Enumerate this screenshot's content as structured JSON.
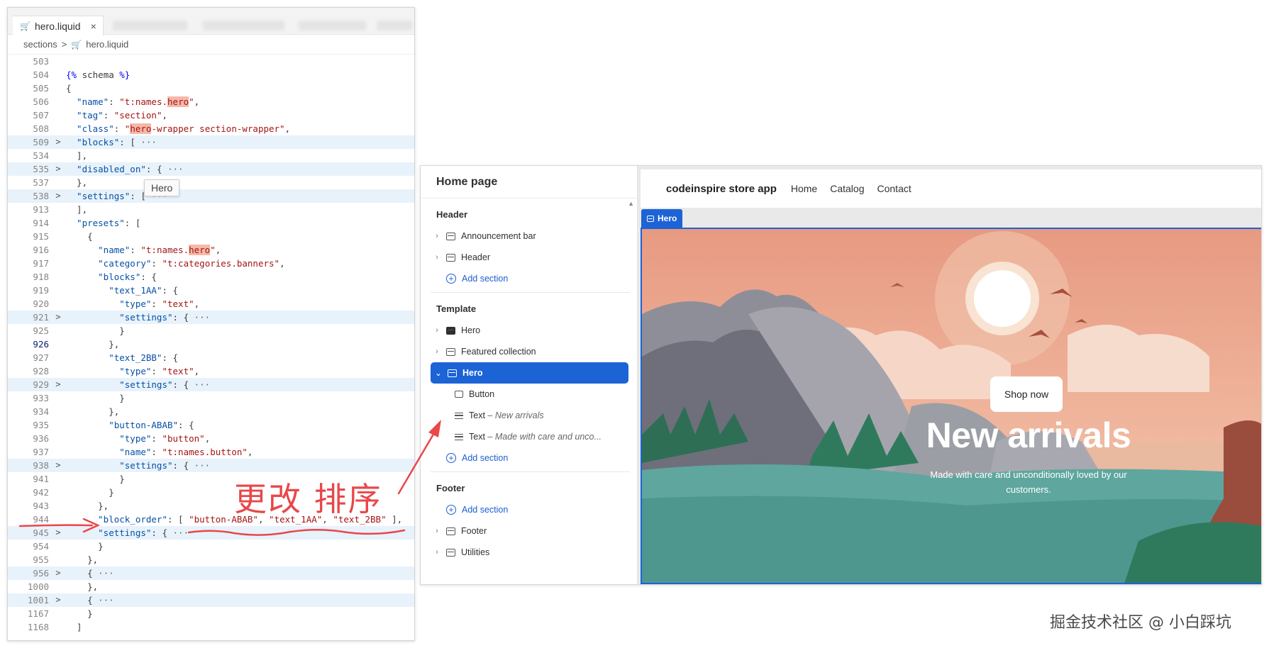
{
  "editor": {
    "tab_label": "hero.liquid",
    "tab_close": "×",
    "breadcrumb": [
      "sections",
      ">",
      "hero.liquid"
    ],
    "hover_tooltip": "Hero",
    "lines": [
      {
        "n": "503",
        "html": ""
      },
      {
        "n": "504",
        "html": "<span class='k'>{%</span> <span class='p'>schema</span> <span class='k'>%}</span>"
      },
      {
        "n": "505",
        "html": "<span class='p'>{</span>"
      },
      {
        "n": "506",
        "html": "  \"name\"<span class='p'>: </span><span class='s'>\"t:names.<span class='mark'>hero</span>\"</span><span class='p'>,</span>"
      },
      {
        "n": "507",
        "html": "  \"tag\"<span class='p'>: </span><span class='s'>\"section\"</span><span class='p'>,</span>"
      },
      {
        "n": "508",
        "html": "  \"class\"<span class='p'>: </span><span class='s'>\"<span class='mark'>hero</span>-wrapper section-wrapper\"</span><span class='p'>,</span>"
      },
      {
        "n": "509",
        "fold": ">",
        "hl": true,
        "html": "  \"blocks\"<span class='p'>: [</span> <span class='m'>···</span>"
      },
      {
        "n": "534",
        "html": "<span class='p'>  ],</span>"
      },
      {
        "n": "535",
        "fold": ">",
        "hl": true,
        "html": "  \"disabled_on\"<span class='p'>: {</span> <span class='m'>···</span>"
      },
      {
        "n": "537",
        "html": "<span class='p'>  },</span>"
      },
      {
        "n": "538",
        "fold": ">",
        "hl": true,
        "html": "  \"settings\"<span class='p'>: [</span> <span class='m'>···</span>"
      },
      {
        "n": "913",
        "html": "<span class='p'>  ],</span>"
      },
      {
        "n": "914",
        "html": "  \"presets\"<span class='p'>: [</span>"
      },
      {
        "n": "915",
        "html": "<span class='p'>    {</span>"
      },
      {
        "n": "916",
        "html": "      \"name\"<span class='p'>: </span><span class='s'>\"t:names.<span class='mark'>hero</span>\"</span><span class='p'>,</span>"
      },
      {
        "n": "917",
        "html": "      \"category\"<span class='p'>: </span><span class='s'>\"t:categories.banners\"</span><span class='p'>,</span>"
      },
      {
        "n": "918",
        "html": "      \"blocks\"<span class='p'>: {</span>"
      },
      {
        "n": "919",
        "html": "        \"text_1AA\"<span class='p'>: {</span>"
      },
      {
        "n": "920",
        "html": "          \"type\"<span class='p'>: </span><span class='s'>\"text\"</span><span class='p'>,</span>"
      },
      {
        "n": "921",
        "fold": ">",
        "hl": true,
        "html": "          \"settings\"<span class='p'>: {</span> <span class='m'>···</span>"
      },
      {
        "n": "925",
        "html": "<span class='p'>          }</span>"
      },
      {
        "n": "926",
        "cur": true,
        "html": "<span class='p'>        },</span>"
      },
      {
        "n": "927",
        "html": "        \"text_2BB\"<span class='p'>: {</span>"
      },
      {
        "n": "928",
        "html": "          \"type\"<span class='p'>: </span><span class='s'>\"text\"</span><span class='p'>,</span>"
      },
      {
        "n": "929",
        "fold": ">",
        "hl": true,
        "html": "          \"settings\"<span class='p'>: {</span> <span class='m'>···</span>"
      },
      {
        "n": "933",
        "html": "<span class='p'>          }</span>"
      },
      {
        "n": "934",
        "html": "<span class='p'>        },</span>"
      },
      {
        "n": "935",
        "html": "        \"button-ABAB\"<span class='p'>: {</span>"
      },
      {
        "n": "936",
        "html": "          \"type\"<span class='p'>: </span><span class='s'>\"button\"</span><span class='p'>,</span>"
      },
      {
        "n": "937",
        "html": "          \"name\"<span class='p'>: </span><span class='s'>\"t:names.button\"</span><span class='p'>,</span>"
      },
      {
        "n": "938",
        "fold": ">",
        "hl": true,
        "html": "          \"settings\"<span class='p'>: {</span> <span class='m'>···</span>"
      },
      {
        "n": "941",
        "html": "<span class='p'>          }</span>"
      },
      {
        "n": "942",
        "html": "<span class='p'>        }</span>"
      },
      {
        "n": "943",
        "html": "<span class='p'>      },</span>"
      },
      {
        "n": "944",
        "html": "      \"block_order\"<span class='p'>: [ </span><span class='s'>\"button-ABAB\"</span><span class='p'>, </span><span class='s'>\"text_1AA\"</span><span class='p'>, </span><span class='s'>\"text_2BB\"</span><span class='p'> ],</span>"
      },
      {
        "n": "945",
        "fold": ">",
        "hl": true,
        "html": "      \"settings\"<span class='p'>: {</span> <span class='m'>···</span>"
      },
      {
        "n": "954",
        "html": "<span class='p'>      }</span>"
      },
      {
        "n": "955",
        "html": "<span class='p'>    },</span>"
      },
      {
        "n": "956",
        "fold": ">",
        "hl": true,
        "html": "<span class='p'>    {</span> <span class='m'>···</span>"
      },
      {
        "n": "1000",
        "html": "<span class='p'>    },</span>"
      },
      {
        "n": "1001",
        "fold": ">",
        "hl": true,
        "html": "<span class='p'>    {</span> <span class='m'>···</span>"
      },
      {
        "n": "1167",
        "html": "<span class='p'>    }</span>"
      },
      {
        "n": "1168",
        "html": "<span class='p'>  ]</span>"
      }
    ]
  },
  "customizer": {
    "panel_title": "Home page",
    "header_group": {
      "title": "Header",
      "items": [
        "Announcement bar",
        "Header"
      ],
      "add_label": "Add section"
    },
    "template_group": {
      "title": "Template",
      "items": [
        "Hero",
        "Featured collection"
      ],
      "selected": "Hero",
      "blocks": [
        {
          "label": "Button",
          "sub": ""
        },
        {
          "label": "Text",
          "sub": " – New arrivals"
        },
        {
          "label": "Text",
          "sub": " – Made with care and unco..."
        }
      ],
      "add_label": "Add section"
    },
    "footer_group": {
      "title": "Footer",
      "add_label": "Add section",
      "items": [
        "Footer",
        "Utilities"
      ]
    },
    "preview": {
      "store_name": "codeinspire store app",
      "nav": [
        "Home",
        "Catalog",
        "Contact"
      ],
      "section_tag": "Hero",
      "button_label": "Shop now",
      "heading": "New arrivals",
      "subheading": "Made with care and unconditionally loved by our customers."
    }
  },
  "annotation": {
    "text": "更改 排序",
    "color": "#e9474a"
  },
  "watermark": "掘金技术社区 @ 小白踩坑",
  "colors": {
    "accent": "#1c63d6",
    "annotation": "#e9474a",
    "string": "#a31515",
    "key": "#0451a5"
  }
}
